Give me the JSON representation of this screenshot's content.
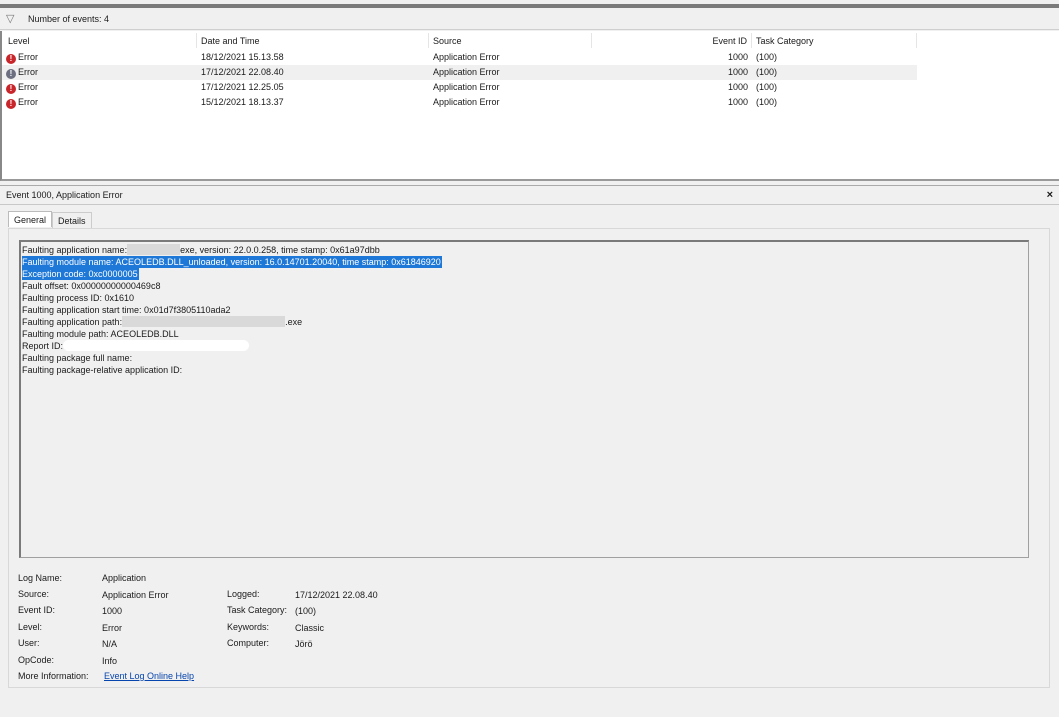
{
  "filter": {
    "icon": "filter-icon",
    "label": "Number of events: 4"
  },
  "columns": [
    "Level",
    "Date and Time",
    "Source",
    "Event ID",
    "Task Category"
  ],
  "events": [
    {
      "level": "Error",
      "datetime": "18/12/2021 15.13.58",
      "source": "Application Error",
      "event_id": "1000",
      "task_category": "(100)"
    },
    {
      "level": "Error",
      "datetime": "17/12/2021 22.08.40",
      "source": "Application Error",
      "event_id": "1000",
      "task_category": "(100)"
    },
    {
      "level": "Error",
      "datetime": "17/12/2021 12.25.05",
      "source": "Application Error",
      "event_id": "1000",
      "task_category": "(100)"
    },
    {
      "level": "Error",
      "datetime": "15/12/2021 18.13.37",
      "source": "Application Error",
      "event_id": "1000",
      "task_category": "(100)"
    }
  ],
  "detail": {
    "title": "Event 1000, Application Error",
    "close": "×",
    "tabs": [
      "General",
      "Details"
    ],
    "lines": {
      "l1a": "Faulting application name:",
      "l1b": "exe, version: 22.0.0.258, time stamp: 0x61a97dbb",
      "l2": "Faulting module name: ACEOLEDB.DLL_unloaded, version: 16.0.14701.20040, time stamp: 0x61846920",
      "l3": "Exception code: 0xc0000005",
      "l4": "Fault offset: 0x00000000000469c8",
      "l5": "Faulting process ID: 0x1610",
      "l6": "Faulting application start time: 0x01d7f3805110ada2",
      "l7a": "Faulting application path:",
      "l7b": ".exe",
      "l8": "Faulting module path: ACEOLEDB.DLL",
      "l9": "Report ID:",
      "l10": "Faulting package full name:",
      "l11": "Faulting package-relative application ID:"
    },
    "props": {
      "log_name_label": "Log Name:",
      "log_name": "Application",
      "source_label": "Source:",
      "source": "Application Error",
      "event_id_label": "Event ID:",
      "event_id": "1000",
      "level_label": "Level:",
      "level": "Error",
      "user_label": "User:",
      "user": "N/A",
      "opcode_label": "OpCode:",
      "opcode": "Info",
      "more_info_label": "More Information:",
      "more_info_link": "Event Log Online Help",
      "logged_label": "Logged:",
      "logged": "17/12/2021 22.08.40",
      "task_category_label": "Task Category:",
      "task_category": "(100)",
      "keywords_label": "Keywords:",
      "keywords": "Classic",
      "computer_label": "Computer:",
      "computer": "Jörö"
    }
  }
}
